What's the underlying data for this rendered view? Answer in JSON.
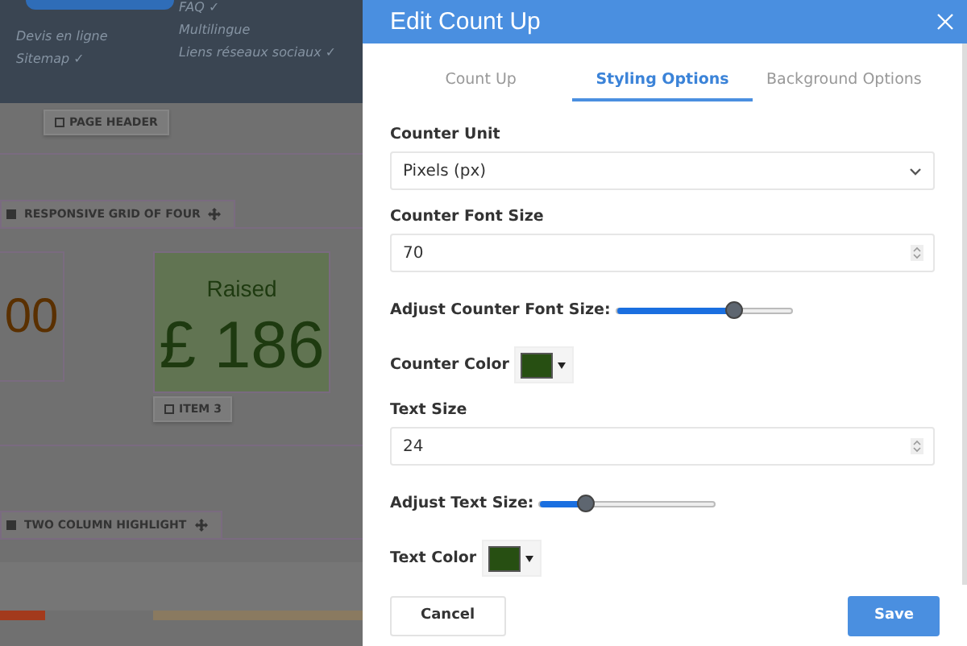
{
  "background": {
    "menu": {
      "column_1": [
        "Devis en ligne",
        "Sitemap ✓"
      ],
      "column_2": [
        "FAQ ✓",
        "Multilingue",
        "Liens réseaux sociaux ✓"
      ]
    },
    "page_header_tag": "PAGE HEADER",
    "grid_tab": "RESPONSIVE GRID OF FOUR",
    "cards": [
      {
        "kind": "plain",
        "value": "00"
      },
      {
        "kind": "counter",
        "text": "Raised",
        "value": "£ 186",
        "tag": "ITEM 3"
      }
    ],
    "highlight_tab": "TWO COLUMN HIGHLIGHT"
  },
  "dialog": {
    "title": "Edit Count Up",
    "tabs": [
      {
        "label": "Count Up",
        "selected": false
      },
      {
        "label": "Styling Options",
        "selected": true
      },
      {
        "label": "Background Options",
        "selected": false
      }
    ],
    "fields": [
      {
        "kind": "select",
        "label": "Counter Unit",
        "value": "Pixels (px)"
      },
      {
        "kind": "number",
        "label": "Counter Font Size",
        "value": "70"
      },
      {
        "kind": "slider",
        "label": "Adjust Counter Font Size:",
        "level": 0.67
      },
      {
        "kind": "color",
        "label": "Counter Color",
        "color": "#274f12"
      },
      {
        "kind": "number",
        "label": "Text Size",
        "value": "24"
      },
      {
        "kind": "slider",
        "label": "Adjust Text Size:",
        "level": 0.26
      },
      {
        "kind": "color",
        "label": "Text Color",
        "color": "#274f12"
      }
    ],
    "buttons": [
      {
        "label": "Cancel",
        "kind": "secondary"
      },
      {
        "label": "Save",
        "kind": "primary"
      }
    ]
  }
}
